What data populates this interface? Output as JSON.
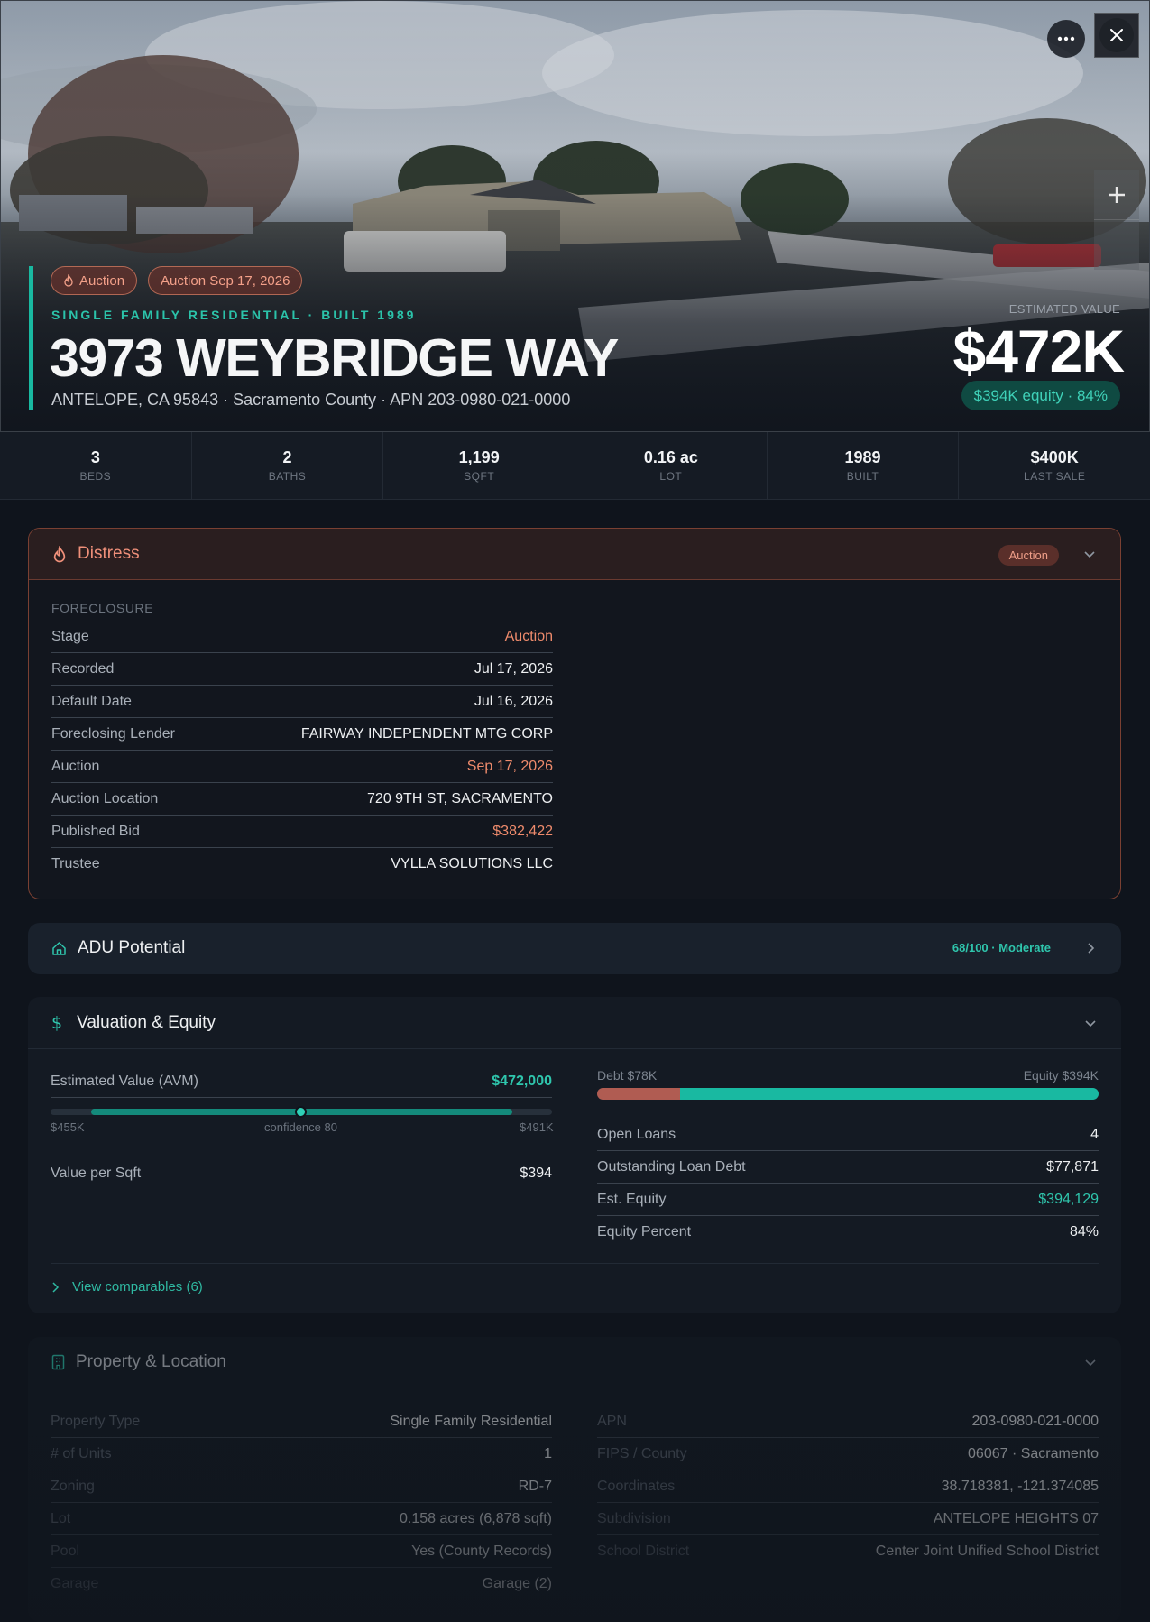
{
  "hero": {
    "badges": {
      "auction": "Auction",
      "auction_date": "Auction Sep 17, 2026"
    },
    "subtitle": "SINGLE FAMILY RESIDENTIAL · BUILT 1989",
    "address": "3973 WEYBRIDGE WAY",
    "location": "ANTELOPE, CA 95843 · Sacramento County · APN 203-0980-021-0000",
    "estimated_label": "ESTIMATED VALUE",
    "estimated_value": "$472K",
    "equity_pill": "$394K equity · 84%"
  },
  "stats": [
    {
      "value": "3",
      "label": "BEDS"
    },
    {
      "value": "2",
      "label": "BATHS"
    },
    {
      "value": "1,199",
      "label": "SQFT"
    },
    {
      "value": "0.16 ac",
      "label": "LOT"
    },
    {
      "value": "1989",
      "label": "BUILT"
    },
    {
      "value": "$400K",
      "label": "LAST SALE"
    }
  ],
  "distress": {
    "title": "Distress",
    "badge": "Auction",
    "section_label": "FORECLOSURE",
    "rows": [
      {
        "key": "Stage",
        "value": "Auction"
      },
      {
        "key": "Recorded",
        "value": "Jul 17, 2026"
      },
      {
        "key": "Default Date",
        "value": "Jul 16, 2026"
      },
      {
        "key": "Foreclosing Lender",
        "value": "FAIRWAY INDEPENDENT MTG CORP"
      },
      {
        "key": "Auction",
        "value": "Sep 17, 2026"
      },
      {
        "key": "Auction Location",
        "value": "720 9TH ST, SACRAMENTO"
      },
      {
        "key": "Published Bid",
        "value": "$382,422"
      },
      {
        "key": "Trustee",
        "value": "VYLLA SOLUTIONS LLC"
      }
    ]
  },
  "adu": {
    "title": "ADU Potential",
    "badge": "68/100 · Moderate"
  },
  "valuation": {
    "title": "Valuation & Equity",
    "avm_label": "Estimated Value (AVM)",
    "avm_value": "$472,000",
    "range_low": "$455K",
    "range_high": "$491K",
    "confidence": "confidence 80",
    "per_sqft_label": "Value per Sqft",
    "per_sqft_value": "$394",
    "debt_label": "Debt $78K",
    "equity_label": "Equity $394K",
    "debt_fraction": 0.165,
    "rows": [
      {
        "key": "Open Loans",
        "value": "4"
      },
      {
        "key": "Outstanding Loan Debt",
        "value": "$77,871"
      },
      {
        "key": "Est. Equity",
        "value": "$394,129"
      },
      {
        "key": "Equity Percent",
        "value": "84%"
      }
    ],
    "comparables": "View comparables (6)"
  },
  "property": {
    "title": "Property & Location",
    "left": [
      {
        "key": "Property Type",
        "value": "Single Family Residential"
      },
      {
        "key": "# of Units",
        "value": "1"
      },
      {
        "key": "Zoning",
        "value": "RD-7"
      },
      {
        "key": "Lot",
        "value": "0.158 acres (6,878 sqft)"
      },
      {
        "key": "Pool",
        "value": "Yes (County Records)"
      },
      {
        "key": "Garage",
        "value": "Garage (2)"
      }
    ],
    "right": [
      {
        "key": "APN",
        "value": "203-0980-021-0000"
      },
      {
        "key": "FIPS / County",
        "value": "06067 · Sacramento"
      },
      {
        "key": "Coordinates",
        "value": "38.718381, -121.374085"
      },
      {
        "key": "Subdivision",
        "value": "ANTELOPE HEIGHTS 07"
      },
      {
        "key": "School District",
        "value": "Center Joint Unified School District"
      }
    ]
  },
  "colors": {
    "accent": "#19b9a1",
    "alert": "#ef8b6c",
    "background": "#0f141c"
  }
}
